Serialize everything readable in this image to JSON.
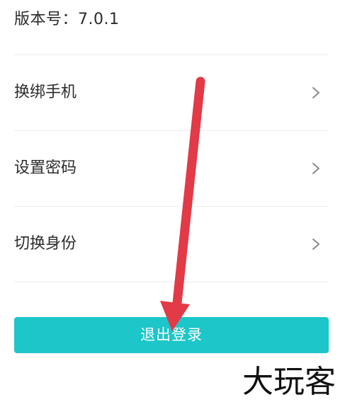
{
  "version": {
    "text": "版本号：7.0.1"
  },
  "menu": {
    "items": [
      {
        "label": "换绑手机"
      },
      {
        "label": "设置密码"
      },
      {
        "label": "切换身份"
      }
    ]
  },
  "logout": {
    "label": "退出登录"
  },
  "annotation": {
    "arrow_color": "#e23a46"
  },
  "watermark": {
    "text": "大玩客"
  },
  "colors": {
    "accent": "#1cc6c9",
    "divider": "#ececec",
    "text": "#2b2b2b",
    "chevron": "#8a8a8a"
  }
}
